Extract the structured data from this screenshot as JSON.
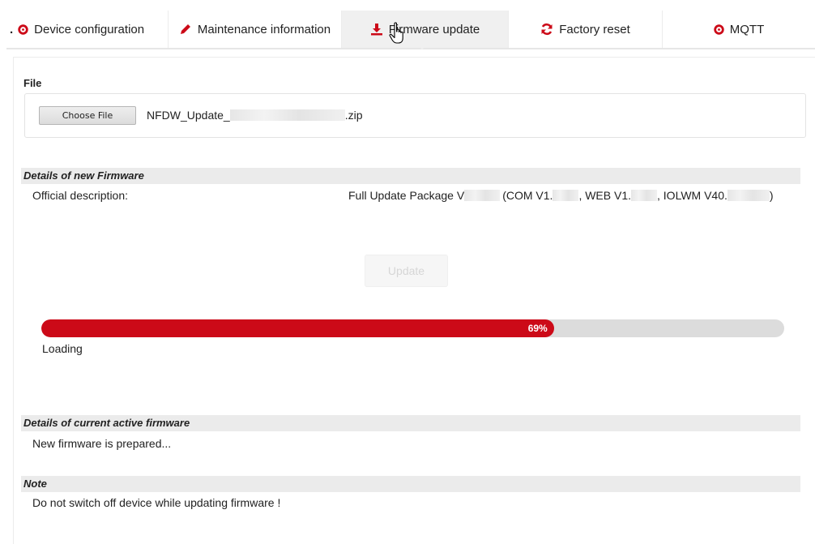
{
  "tabs": [
    {
      "label": "Device configuration",
      "icon": "gear-icon",
      "active": false
    },
    {
      "label": "Maintenance information",
      "icon": "pencil-icon",
      "active": false
    },
    {
      "label": "Firmware update",
      "icon": "download-icon",
      "active": true
    },
    {
      "label": "Factory reset",
      "icon": "refresh-icon",
      "active": false
    },
    {
      "label": "MQTT",
      "icon": "gear-icon",
      "active": false
    }
  ],
  "colors": {
    "accent": "#cc0a18",
    "section_bg": "#ebebeb"
  },
  "file": {
    "label": "File",
    "choose_button": "Choose File",
    "name_prefix": "NFDW_Update_",
    "name_suffix": ".zip"
  },
  "new_firmware": {
    "header": "Details of new Firmware",
    "description_label": "Official description:",
    "description_parts": [
      "Full Update Package V",
      "(COM V1.",
      ", WEB V1.",
      ", IOLWM V40.",
      ")"
    ]
  },
  "update_button": "Update",
  "progress": {
    "percent": 69,
    "label": "69%",
    "status": "Loading"
  },
  "current_firmware": {
    "header": "Details of current active firmware",
    "text": "New firmware is prepared..."
  },
  "note": {
    "header": "Note",
    "text": "Do not switch off device while updating firmware !"
  }
}
